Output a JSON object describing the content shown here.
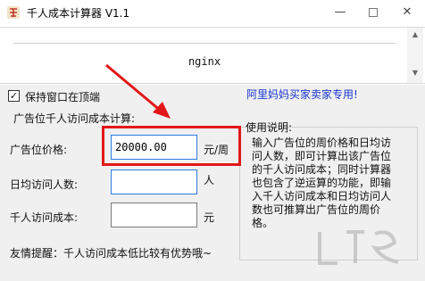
{
  "window": {
    "title": "千人成本计算器 V1.1",
    "icon": "cpm-app-icon",
    "minimize_icon": "minimize-icon",
    "maximize_icon": "maximize-icon",
    "close_icon": "close-icon",
    "close_glyph": "✕",
    "minimize_glyph": "—"
  },
  "url_panel": {
    "text": "nginx",
    "scroll_up": "▲",
    "scroll_down": "▼"
  },
  "options": {
    "keep_on_top_label": "保持窗口在顶端",
    "keep_on_top_checked": true,
    "check_glyph": "✓"
  },
  "brand_link": "阿里妈妈买家卖家专用!",
  "calculator": {
    "group_title": "广告位千人访问成本计算:",
    "fields": [
      {
        "label": "广告位价格:",
        "value": "20000.00",
        "unit": "元/周"
      },
      {
        "label": "日均访问人数:",
        "value": "",
        "unit": "人"
      },
      {
        "label": "千人访问成本:",
        "value": "",
        "unit": "元"
      }
    ]
  },
  "usage": {
    "title": "使用说明:",
    "text": "输入广告位的周价格和日均访问人数，即可计算出该广告位的千人访问成本；同时计算器也包含了逆运算的功能，即输入千人访问成本和日均访问人数也可推算出广告位的周价格。"
  },
  "tip": "友情提醒：千人访问成本低比较有优势哦~",
  "annotation": {
    "color": "#e21818"
  }
}
